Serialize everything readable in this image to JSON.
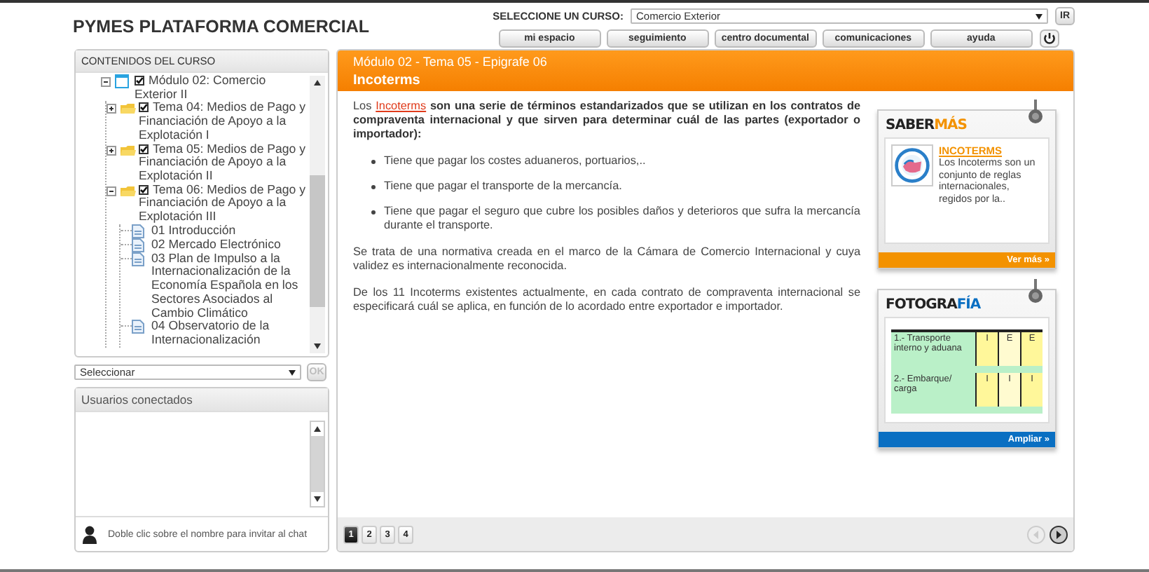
{
  "header": {
    "title": "PYMES PLATAFORMA COMERCIAL",
    "course_label": "SELECCIONE UN CURSO:",
    "course_value": "Comercio Exterior",
    "go_button": "IR",
    "nav_buttons": [
      "mi espacio",
      "seguimiento",
      "centro documental",
      "comunicaciones",
      "ayuda"
    ]
  },
  "course_contents": {
    "title": "CONTENIDOS DEL CURSO",
    "tree": [
      {
        "kind": "module",
        "label": "Módulo 02: Comercio Exterior II",
        "checked": true,
        "expanded": true,
        "children": [
          {
            "kind": "folder",
            "label": "Tema 04: Medios de Pago y Financiación de Apoyo a la Explotación I",
            "checked": true,
            "expanded": false
          },
          {
            "kind": "folder",
            "label": "Tema 05: Medios de Pago y Financiación de Apoyo a la Explotación II",
            "checked": true,
            "expanded": false
          },
          {
            "kind": "folder",
            "label": "Tema 06: Medios de Pago y Financiación de Apoyo a la Explotación III",
            "checked": true,
            "expanded": true,
            "children": [
              {
                "kind": "document",
                "label": "01 Introducción"
              },
              {
                "kind": "document",
                "label": "02 Mercado Electrónico"
              },
              {
                "kind": "document",
                "label": "03 Plan de Impulso a la Internacionalización de la Economía Española en los Sectores Asociados al Cambio Climático"
              },
              {
                "kind": "document",
                "label": "04 Observatorio de la Internacionalización"
              }
            ]
          }
        ]
      }
    ],
    "select_value": "Seleccionar",
    "ok_button": "OK",
    "ok_disabled": true
  },
  "users": {
    "title": "Usuarios conectados",
    "hint": "Doble clic sobre el nombre para invitar al chat"
  },
  "lesson": {
    "breadcrumb": "Módulo 02 - Tema 05 - Epigrafe 06",
    "title": "Incoterms",
    "intro": {
      "lead": "Los",
      "link": "Incoterms",
      "rest": "son una serie de términos estandarizados que se utilizan en los contratos de compraventa internacional y que sirven para determinar cuál de las partes (exportador o importador):"
    },
    "bullets": [
      "Tiene que pagar los costes aduaneros, portuarios,..",
      "Tiene que pagar el transporte de la mercancía.",
      "Tiene que pagar el seguro que cubre los posibles daños y deterioros que sufra la mercancía durante el transporte."
    ],
    "paragraphs": [
      "Se trata de una normativa creada en el marco de la Cámara de Comercio Internacional y cuya validez es internacionalmente reconocida.",
      "De los 11 Incoterms existentes actualmente, en cada contrato de compraventa internacional se especificará cuál se aplica, en función de lo acordado entre exportador e importador."
    ]
  },
  "side_cards": [
    {
      "kind": "article",
      "title": "SABER",
      "title_accent": "MÁS",
      "color": "#f39200",
      "link": "INCOTERMS",
      "text": "Los Incoterms son un conjunto de reglas internacionales, regidos por la..",
      "footer": "Ver más »"
    },
    {
      "kind": "table",
      "title": "FOTOGRA",
      "title_accent": "FÍA",
      "color": "#0a6fc2",
      "rows": [
        {
          "label": "1.- Transporte interno y aduana",
          "cells": [
            "I",
            "E",
            "E"
          ]
        },
        {
          "label": "2.- Embarque/ carga",
          "cells": [
            "I",
            "I",
            "I"
          ]
        }
      ],
      "footer": "Ampliar »"
    }
  ],
  "pagination": {
    "pages": [
      {
        "label": "1",
        "selected": true
      },
      {
        "label": "2",
        "selected": false
      },
      {
        "label": "3",
        "selected": false
      },
      {
        "label": "4",
        "selected": false
      }
    ],
    "prev_disabled": true,
    "next_disabled": false
  }
}
